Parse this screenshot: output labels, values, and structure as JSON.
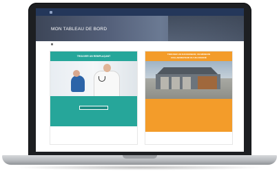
{
  "nav": {
    "items": [
      "",
      "",
      ""
    ]
  },
  "hero": {
    "title": "MON TABLEAU DE BORD"
  },
  "breadcrumb": {
    "items": [
      "",
      ""
    ]
  },
  "user_line": "",
  "left_card": {
    "heading": "TROUVER UN REMPLAÇANT",
    "stat": "",
    "period": "",
    "button": "",
    "footer": ""
  },
  "right_card": {
    "heading_line1": "TROUVER UN SUCCESSEUR, UN MÉDECIN",
    "heading_line2": "COLLABORATEUR OU UN ASSOCIÉ",
    "body_lines": [
      "",
      "",
      ""
    ],
    "footer_lines": [
      "",
      ""
    ]
  },
  "colors": {
    "teal": "#26a69a",
    "orange": "#f39c2a",
    "navy": "#24375a"
  }
}
